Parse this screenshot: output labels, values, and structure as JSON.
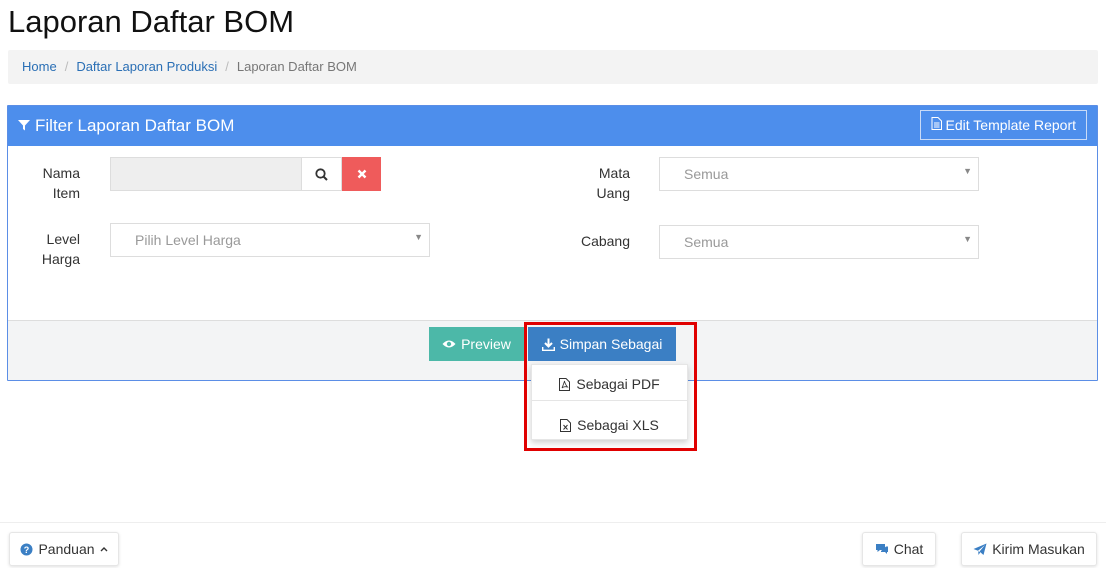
{
  "page": {
    "title": "Laporan Daftar BOM"
  },
  "breadcrumb": {
    "home": "Home",
    "parent": "Daftar Laporan Produksi",
    "current": "Laporan Daftar BOM",
    "separator": "/"
  },
  "filter": {
    "title": "Filter Laporan Daftar BOM",
    "edit_template": "Edit Template Report",
    "nama_item": {
      "label_line1": "Nama",
      "label_line2": "Item",
      "value": ""
    },
    "level_harga": {
      "label_line1": "Level",
      "label_line2": "Harga",
      "placeholder": "Pilih Level Harga"
    },
    "mata_uang": {
      "label_line1": "Mata",
      "label_line2": "Uang",
      "value": "Semua"
    },
    "cabang": {
      "label": "Cabang",
      "value": "Semua"
    }
  },
  "actions": {
    "preview": "Preview",
    "save_as": "Simpan Sebagai"
  },
  "save_menu": {
    "pdf": "Sebagai PDF",
    "xls": "Sebagai XLS"
  },
  "footer": {
    "guide": "Panduan",
    "chat": "Chat",
    "feedback": "Kirim Masukan"
  },
  "colors": {
    "panel_header": "#4d8eec",
    "preview": "#4cb8a8",
    "save": "#3b7fc4",
    "clear": "#ef5b5b",
    "highlight": "#e00000"
  }
}
